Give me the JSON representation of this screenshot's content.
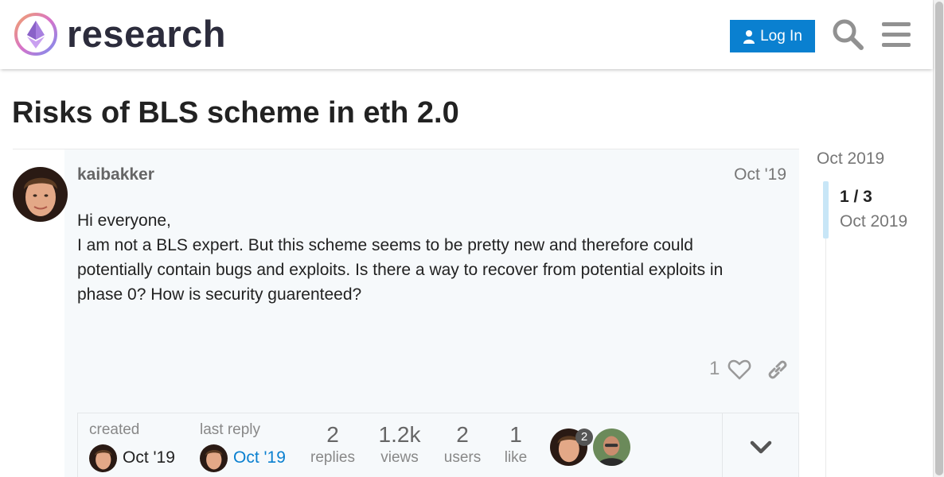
{
  "header": {
    "logo_text": "research",
    "login_label": "Log In",
    "search_icon": "search-icon",
    "menu_icon": "hamburger-icon"
  },
  "topic": {
    "title": "Risks of BLS scheme in eth 2.0"
  },
  "post": {
    "username": "kaibakker",
    "date": "Oct '19",
    "body": [
      "Hi everyone,",
      "I am not a BLS expert. But this scheme seems to be pretty new and therefore could potentially contain bugs and exploits. Is there a way to recover from potential exploits in phase 0? How is security guarenteed?"
    ],
    "like_count": "1"
  },
  "topic_map": {
    "created_label": "created",
    "created_date": "Oct '19",
    "last_reply_label": "last reply",
    "last_reply_date": "Oct '19",
    "stats": [
      {
        "value": "2",
        "label": "replies"
      },
      {
        "value": "1.2k",
        "label": "views"
      },
      {
        "value": "2",
        "label": "users"
      },
      {
        "value": "1",
        "label": "like"
      }
    ],
    "participant_badge": "2"
  },
  "timeline": {
    "start_date": "Oct 2019",
    "position": "1 / 3",
    "current_date": "Oct 2019"
  },
  "colors": {
    "accent": "#0a80d0",
    "post_bg": "#f6f9fb",
    "last_reply_link": "#0a80d0"
  }
}
